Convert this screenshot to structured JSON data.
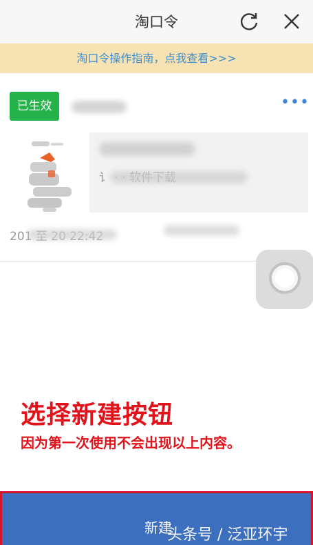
{
  "header": {
    "title": "淘口令",
    "refresh_icon": "refresh-icon",
    "close_icon": "close-icon"
  },
  "banner": {
    "text": "淘口令操作指南，点我查看>>>"
  },
  "card": {
    "status_badge": "已生效",
    "more_icon": "more-dots-icon",
    "more_text": "•••",
    "preview_desc": "讠          ·  · 软件下载",
    "validity": "201                                至 20           22:42"
  },
  "floating_button": {
    "icon": "assistive-touch-icon"
  },
  "annotation": {
    "title": "选择新建按钮",
    "subtitle": "因为第一次使用不会出现以上内容。"
  },
  "bottom_bar": {
    "new_label": "新建",
    "watermark": "头条号 / 泛亚环宇"
  },
  "colors": {
    "badge_green": "#26b24a",
    "banner_bg": "#f6e2b2",
    "banner_text": "#3f8fd0",
    "annotation_red": "#e2121b",
    "button_blue": "#3d6fbf"
  }
}
